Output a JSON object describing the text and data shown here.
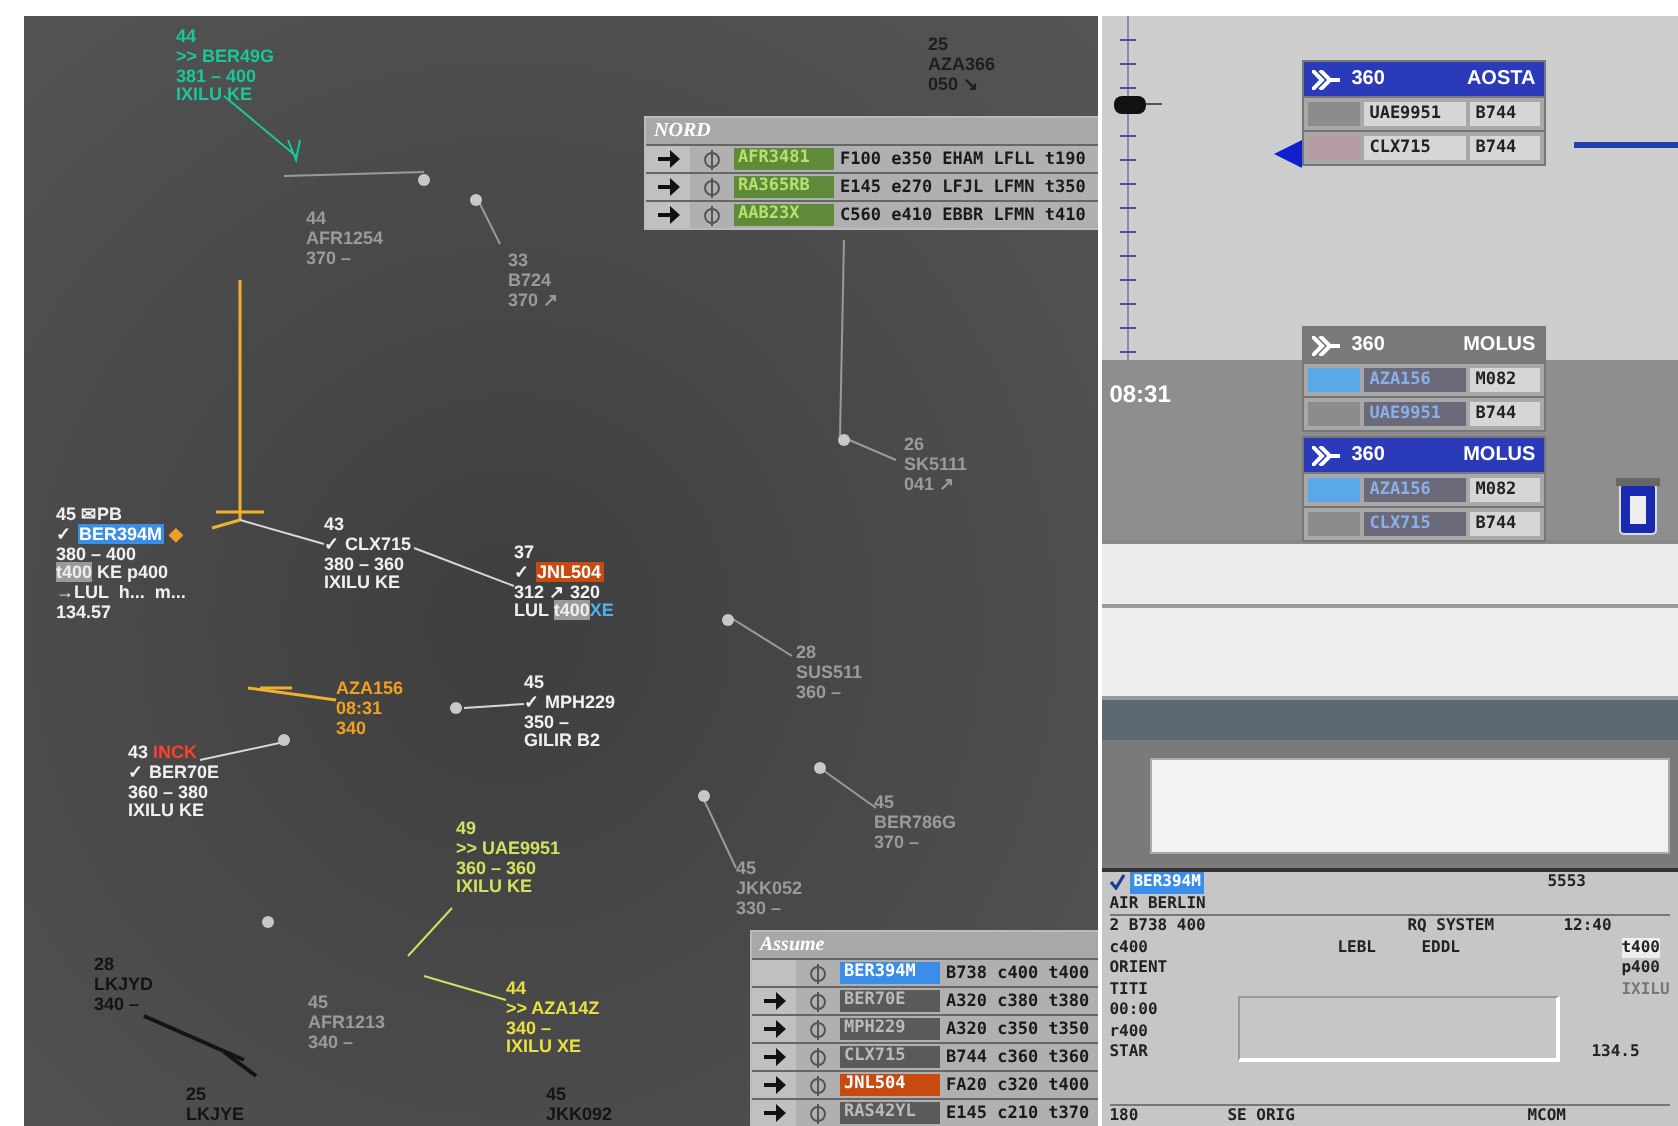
{
  "radar": {
    "labels": [
      {
        "color": "#19c79a",
        "lines": [
          [
            {
              "text": "44",
              "kind": "plain"
            }
          ],
          [
            {
              "text": ">> BER49G",
              "kind": "plain"
            }
          ],
          [
            {
              "text": "381 – 400",
              "kind": "plain"
            }
          ],
          [
            {
              "text": "IXILU KE",
              "kind": "plain"
            }
          ]
        ]
      },
      {
        "color": "#9a9a9a",
        "lines": [
          [
            {
              "text": "44",
              "kind": "plain"
            }
          ],
          [
            {
              "text": "AFR1254",
              "kind": "plain"
            }
          ],
          [
            {
              "text": "370 –",
              "kind": "plain"
            }
          ]
        ]
      },
      {
        "color": "#9a9a9a",
        "lines": [
          [
            {
              "text": "33",
              "kind": "plain"
            }
          ],
          [
            {
              "text": "B724",
              "kind": "plain"
            }
          ],
          [
            {
              "text": "370 ↗",
              "kind": "plain"
            }
          ]
        ]
      },
      {
        "color": "#1e1e1e",
        "lines": [
          [
            {
              "text": "25",
              "kind": "plain"
            }
          ],
          [
            {
              "text": "AZA366",
              "kind": "plain"
            }
          ],
          [
            {
              "text": "050 ↘",
              "kind": "plain"
            }
          ]
        ]
      },
      {
        "color": "#9a9a9a",
        "lines": [
          [
            {
              "text": "26",
              "kind": "plain"
            }
          ],
          [
            {
              "text": "SK5111",
              "kind": "plain"
            }
          ],
          [
            {
              "text": "041 ↗",
              "kind": "plain"
            }
          ]
        ]
      },
      {
        "color": "#f0f0f0",
        "lines": [
          [
            {
              "text": "45 ✉PB",
              "kind": "plain"
            }
          ],
          [
            {
              "text": "✓ ",
              "kind": "plain"
            },
            {
              "text": "BER394M",
              "kind": "sel"
            },
            {
              "text": " ◆",
              "kind": "orange"
            }
          ],
          [
            {
              "text": "380 – 400",
              "kind": "plain"
            }
          ],
          [
            {
              "text": "t400",
              "kind": "box"
            },
            {
              "text": " KE p400",
              "kind": "plain"
            }
          ],
          [
            {
              "text": "→LUL  h...  m...",
              "kind": "plain"
            }
          ],
          [
            {
              "text": "134.57",
              "kind": "plain"
            }
          ]
        ]
      },
      {
        "color": "#f0f0f0",
        "lines": [
          [
            {
              "text": "43",
              "kind": "plain"
            }
          ],
          [
            {
              "text": "✓ CLX715",
              "kind": "plain"
            }
          ],
          [
            {
              "text": "380 – 360",
              "kind": "plain"
            }
          ],
          [
            {
              "text": "IXILU KE",
              "kind": "plain"
            }
          ]
        ]
      },
      {
        "color": "#f0f0f0",
        "lines": [
          [
            {
              "text": "37",
              "kind": "plain"
            }
          ],
          [
            {
              "text": "✓ ",
              "kind": "plain"
            },
            {
              "text": "JNL504",
              "kind": "alert"
            }
          ],
          [
            {
              "text": "312 ↗ 320",
              "kind": "plain"
            }
          ],
          [
            {
              "text": "LUL ",
              "kind": "plain"
            },
            {
              "text": "t400",
              "kind": "box"
            },
            {
              "text": "XE",
              "kind": "cyan"
            }
          ]
        ]
      },
      {
        "color": "#f0a020",
        "lines": [
          [
            {
              "text": "AZA156",
              "kind": "plain"
            }
          ],
          [
            {
              "text": "08:31",
              "kind": "plain"
            }
          ],
          [
            {
              "text": "340",
              "kind": "plain"
            }
          ]
        ]
      },
      {
        "color": "#f0f0f0",
        "lines": [
          [
            {
              "text": "45",
              "kind": "plain"
            }
          ],
          [
            {
              "text": "✓ MPH229",
              "kind": "plain"
            }
          ],
          [
            {
              "text": "350 –",
              "kind": "plain"
            }
          ],
          [
            {
              "text": "GILIR B2",
              "kind": "plain"
            }
          ]
        ]
      },
      {
        "color": "#f0f0f0",
        "lines": [
          [
            {
              "text": "43 ",
              "kind": "plain"
            },
            {
              "text": "INCK",
              "kind": "warn"
            }
          ],
          [
            {
              "text": "✓ BER70E",
              "kind": "plain"
            }
          ],
          [
            {
              "text": "360 – 380",
              "kind": "plain"
            }
          ],
          [
            {
              "text": "IXILU KE",
              "kind": "plain"
            }
          ]
        ]
      },
      {
        "color": "#9a9a9a",
        "lines": [
          [
            {
              "text": "28",
              "kind": "plain"
            }
          ],
          [
            {
              "text": "SUS511",
              "kind": "plain"
            }
          ],
          [
            {
              "text": "360 –",
              "kind": "plain"
            }
          ]
        ]
      },
      {
        "color": "#9a9a9a",
        "lines": [
          [
            {
              "text": "45",
              "kind": "plain"
            }
          ],
          [
            {
              "text": "BER786G",
              "kind": "plain"
            }
          ],
          [
            {
              "text": "370 –",
              "kind": "plain"
            }
          ]
        ]
      },
      {
        "color": "#9a9a9a",
        "lines": [
          [
            {
              "text": "45",
              "kind": "plain"
            }
          ],
          [
            {
              "text": "JKK052",
              "kind": "plain"
            }
          ],
          [
            {
              "text": "330 –",
              "kind": "plain"
            }
          ]
        ]
      },
      {
        "color": "#d4e060",
        "lines": [
          [
            {
              "text": "49",
              "kind": "plain"
            }
          ],
          [
            {
              "text": ">> UAE9951",
              "kind": "plain"
            }
          ],
          [
            {
              "text": "360 – 360",
              "kind": "plain"
            }
          ],
          [
            {
              "text": "IXILU KE",
              "kind": "plain"
            }
          ]
        ]
      },
      {
        "color": "#141414",
        "lines": [
          [
            {
              "text": "28",
              "kind": "plain"
            }
          ],
          [
            {
              "text": "LKJYD",
              "kind": "plain"
            }
          ],
          [
            {
              "text": "340 –",
              "kind": "plain"
            }
          ]
        ]
      },
      {
        "color": "#9a9a9a",
        "lines": [
          [
            {
              "text": "45",
              "kind": "plain"
            }
          ],
          [
            {
              "text": "AFR1213",
              "kind": "plain"
            }
          ],
          [
            {
              "text": "340 –",
              "kind": "plain"
            }
          ]
        ]
      },
      {
        "color": "#e8e040",
        "lines": [
          [
            {
              "text": "44",
              "kind": "plain"
            }
          ],
          [
            {
              "text": ">> AZA14Z",
              "kind": "plain"
            }
          ],
          [
            {
              "text": "340 –",
              "kind": "plain"
            }
          ],
          [
            {
              "text": "IXILU XE",
              "kind": "plain"
            }
          ]
        ]
      },
      {
        "color": "#141414",
        "lines": [
          [
            {
              "text": "25",
              "kind": "plain"
            }
          ],
          [
            {
              "text": "LKJYE",
              "kind": "plain"
            }
          ]
        ]
      },
      {
        "color": "#141414",
        "lines": [
          [
            {
              "text": "45",
              "kind": "plain"
            }
          ],
          [
            {
              "text": "JKK092",
              "kind": "plain"
            }
          ]
        ]
      }
    ],
    "lists": [
      {
        "title": "NORD",
        "rows": [
          {
            "arrow": true,
            "callsign": "AFR3481",
            "kind": "green",
            "details": "F100 e350 EHAM LFLL t190"
          },
          {
            "arrow": true,
            "callsign": "RA365RB",
            "kind": "green",
            "details": "E145 e270 LFJL LFMN t350"
          },
          {
            "arrow": true,
            "callsign": "AAB23X",
            "kind": "green",
            "details": "C560 e410 EBBR LFMN t410"
          }
        ]
      },
      {
        "title": "Assume",
        "rows": [
          {
            "arrow": false,
            "callsign": "BER394M",
            "kind": "sel",
            "details": "B738 c400 t400"
          },
          {
            "arrow": true,
            "callsign": "BER70E",
            "kind": "plain",
            "details": "A320 c380 t380"
          },
          {
            "arrow": true,
            "callsign": "MPH229",
            "kind": "plain",
            "details": "A320 c350 t350"
          },
          {
            "arrow": true,
            "callsign": "CLX715",
            "kind": "plain",
            "details": "B744 c360 t360"
          },
          {
            "arrow": true,
            "callsign": "JNL504",
            "kind": "alert",
            "details": "FA20 c320 t400"
          },
          {
            "arrow": true,
            "callsign": "RAS42YL",
            "kind": "plain",
            "details": "E145 c210 t370"
          }
        ]
      }
    ]
  },
  "stack_panel": {
    "time": "08:31",
    "stacks": [
      {
        "level": "360",
        "fix": "AOSTA",
        "active": true,
        "rows": [
          {
            "callsign": "UAE9951",
            "type": "B744",
            "color": "#8c8c8c",
            "faded": false
          },
          {
            "callsign": "CLX715",
            "type": "B744",
            "color": "#b89ca4",
            "faded": false
          }
        ]
      },
      {
        "level": "360",
        "fix": "MOLUS",
        "active": false,
        "rows": [
          {
            "callsign": "AZA156",
            "type": "M082",
            "color": "#5aa8e8",
            "faded": true
          },
          {
            "callsign": "UAE9951",
            "type": "B744",
            "color": "#8c8c8c",
            "faded": true
          }
        ]
      },
      {
        "level": "360",
        "fix": "MOLUS",
        "active": true,
        "rows": [
          {
            "callsign": "AZA156",
            "type": "M082",
            "color": "#5aa8e8",
            "faded": true
          },
          {
            "callsign": "CLX715",
            "type": "B744",
            "color": "#8c8c8c",
            "faded": true
          }
        ]
      }
    ]
  },
  "strip": {
    "checked": true,
    "callsign": "BER394M",
    "squawk": "5553",
    "operator": "AIR BERLIN",
    "type": "2  B738 400",
    "request": "RQ SYSTEM",
    "time": "12:40",
    "cleared": "c400",
    "departure": "LEBL",
    "destination": "EDDL",
    "transfer": "t400",
    "orient": "ORIENT",
    "planned": "p400",
    "point": "TITI",
    "point_time": "00:00",
    "requested": "r400",
    "exit_point": "IXILU",
    "star": "STAR",
    "frequency": "134.5",
    "speed": "180",
    "origin": "SE ORIG",
    "mcom": "MCOM"
  }
}
